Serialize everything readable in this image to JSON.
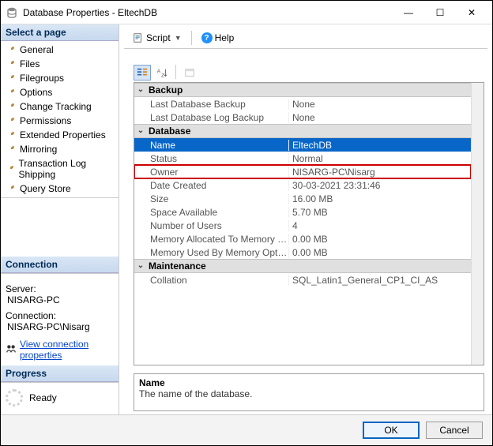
{
  "window": {
    "title": "Database Properties - EltechDB"
  },
  "winbtns": {
    "min": "—",
    "max": "☐",
    "close": "✕"
  },
  "left": {
    "select_page": "Select a page",
    "pages": [
      "General",
      "Files",
      "Filegroups",
      "Options",
      "Change Tracking",
      "Permissions",
      "Extended Properties",
      "Mirroring",
      "Transaction Log Shipping",
      "Query Store"
    ],
    "connection_hdr": "Connection",
    "server_lbl": "Server:",
    "server_val": "NISARG-PC",
    "conn_lbl": "Connection:",
    "conn_val": "NISARG-PC\\Nisarg",
    "view_conn": "View connection properties",
    "progress_hdr": "Progress",
    "progress_val": "Ready"
  },
  "toolbar": {
    "script": "Script",
    "help": "Help"
  },
  "grid": {
    "categories": [
      {
        "name": "Backup",
        "rows": [
          {
            "k": "Last Database Backup",
            "v": "None"
          },
          {
            "k": "Last Database Log Backup",
            "v": "None"
          }
        ]
      },
      {
        "name": "Database",
        "rows": [
          {
            "k": "Name",
            "v": "EltechDB",
            "selected": true
          },
          {
            "k": "Status",
            "v": "Normal"
          },
          {
            "k": "Owner",
            "v": "NISARG-PC\\Nisarg",
            "hl": true
          },
          {
            "k": "Date Created",
            "v": "30-03-2021 23:31:46"
          },
          {
            "k": "Size",
            "v": "16.00 MB"
          },
          {
            "k": "Space Available",
            "v": "5.70 MB"
          },
          {
            "k": "Number of Users",
            "v": "4"
          },
          {
            "k": "Memory Allocated To Memory Optimized Objects",
            "v": "0.00 MB"
          },
          {
            "k": "Memory Used By Memory Optimized Objects",
            "v": "0.00 MB"
          }
        ]
      },
      {
        "name": "Maintenance",
        "rows": [
          {
            "k": "Collation",
            "v": "SQL_Latin1_General_CP1_CI_AS"
          }
        ]
      }
    ]
  },
  "desc": {
    "name": "Name",
    "text": "The name of the database."
  },
  "footer": {
    "ok": "OK",
    "cancel": "Cancel"
  }
}
